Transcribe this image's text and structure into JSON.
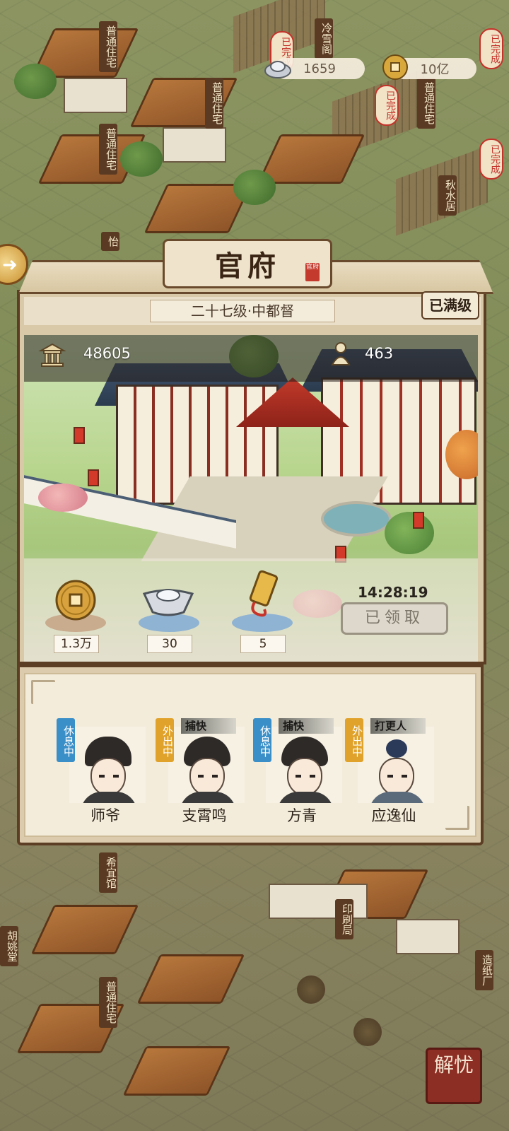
{
  "resources": {
    "silver": {
      "icon": "silver-ingot-icon",
      "value": "1659"
    },
    "coins": {
      "icon": "copper-coin-icon",
      "value": "10亿"
    }
  },
  "map": {
    "labels": [
      "普通住宅",
      "普通住宅",
      "普通住宅",
      "普通住宅",
      "冷雪阁",
      "秋水居",
      "怡",
      "希宜馆",
      "印刷局",
      "造纸厂",
      "普通住宅",
      "胡姚堂"
    ],
    "done_tags": [
      "已完成",
      "已完成",
      "已完成",
      "已完成"
    ]
  },
  "office": {
    "title": "官府",
    "stamp": "官府",
    "level": "二十七级·中都督",
    "max_label": "已满级",
    "stats": {
      "prestige": {
        "icon": "pavilion-icon",
        "value": "48605"
      },
      "people": {
        "icon": "gourd-icon",
        "value": "463"
      }
    },
    "rewards": [
      {
        "icon": "copper-coin-icon",
        "value": "1.3万"
      },
      {
        "icon": "silver-ingot-icon",
        "value": "30"
      },
      {
        "icon": "scroll-order-icon",
        "value": "5"
      }
    ],
    "timer": "14:28:19",
    "claim_button": "已领取"
  },
  "staff": [
    {
      "name": "师爷",
      "status": "休息中",
      "status_color": "#3a8fc8",
      "role": ""
    },
    {
      "name": "支霄鸣",
      "status": "外出中",
      "status_color": "#e0a22a",
      "role": "捕快"
    },
    {
      "name": "方青",
      "status": "休息中",
      "status_color": "#3a8fc8",
      "role": "捕快"
    },
    {
      "name": "应逸仙",
      "status": "外出中",
      "status_color": "#e0a22a",
      "role": "打更人"
    }
  ],
  "bottom_button": "解忧"
}
